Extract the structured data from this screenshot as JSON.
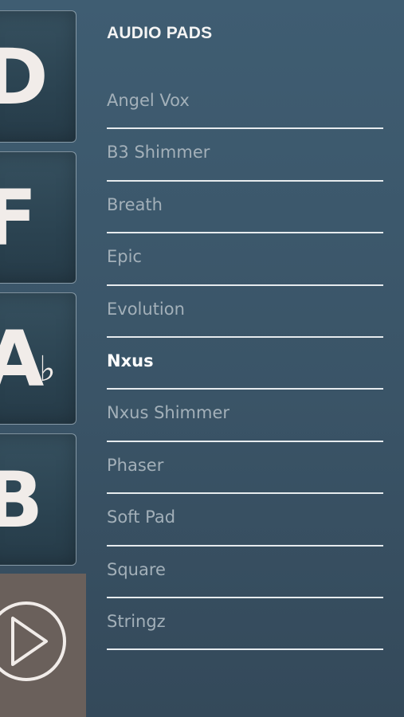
{
  "keys": [
    {
      "letter": "D",
      "accidental": ""
    },
    {
      "letter": "F",
      "accidental": ""
    },
    {
      "letter": "A",
      "accidental": "♭"
    },
    {
      "letter": "B",
      "accidental": ""
    }
  ],
  "play_button": {
    "icon": "play-icon"
  },
  "panel": {
    "title": "AUDIO PADS",
    "selected": "Nxus",
    "items": [
      "Angel Vox",
      "B3 Shimmer",
      "Breath",
      "Epic",
      "Evolution",
      "Nxus",
      "Nxus Shimmer",
      "Phaser",
      "Soft Pad",
      "Square",
      "Stringz"
    ]
  },
  "colors": {
    "background": "#3c586c",
    "item_text": "#a3b0b9",
    "selected_text": "#ffffff",
    "divider": "#e6ebee",
    "play_area": "#6a605b"
  }
}
